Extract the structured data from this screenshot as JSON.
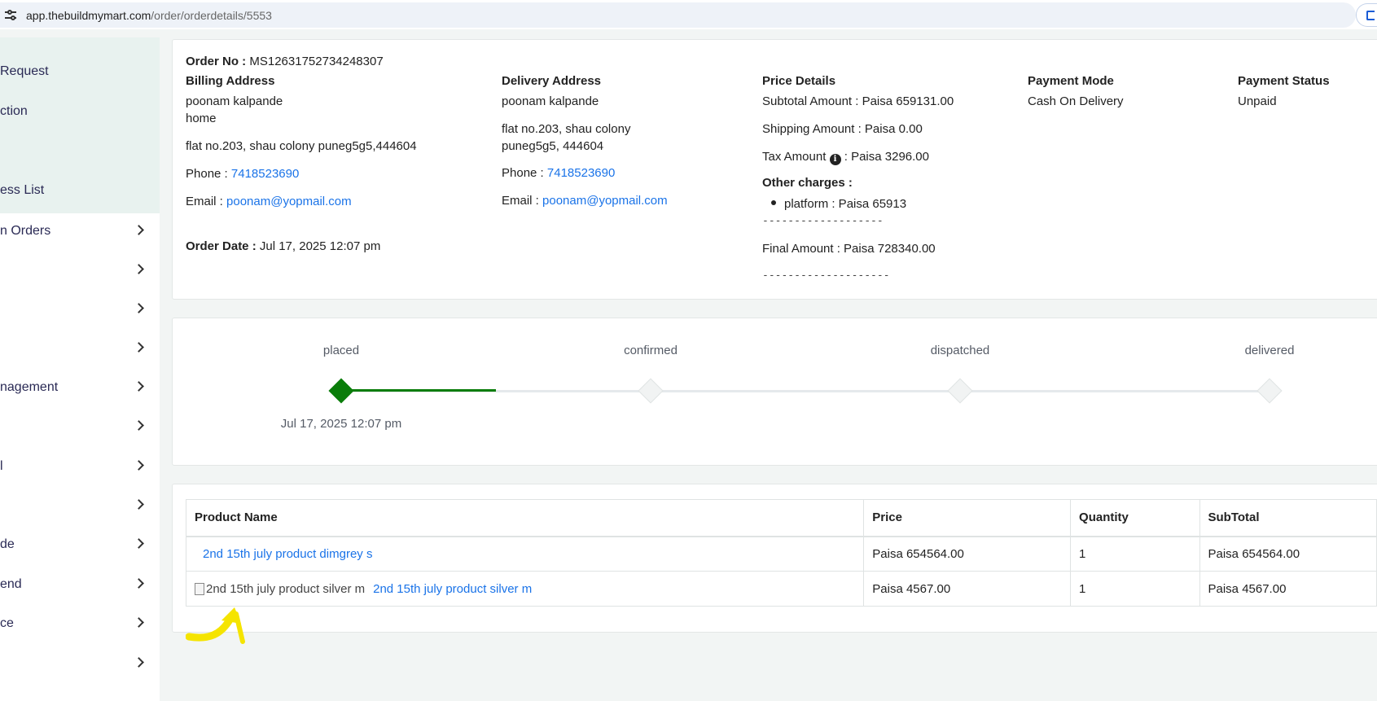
{
  "browser": {
    "url_host": "app.thebuildmymart.com",
    "url_path": "/order/orderdetails/5553"
  },
  "sidebar": {
    "items": [
      {
        "label": "Request",
        "chevron": false
      },
      {
        "label": "ction",
        "chevron": false
      },
      {
        "label": "ess List",
        "chevron": false
      },
      {
        "label": "n Orders",
        "chevron": true
      },
      {
        "label": "",
        "chevron": true
      },
      {
        "label": "",
        "chevron": true
      },
      {
        "label": "",
        "chevron": true
      },
      {
        "label": "nagement",
        "chevron": true
      },
      {
        "label": "",
        "chevron": true
      },
      {
        "label": "l",
        "chevron": true
      },
      {
        "label": "",
        "chevron": true
      },
      {
        "label": "de",
        "chevron": true
      },
      {
        "label": "end",
        "chevron": true
      },
      {
        "label": "ce",
        "chevron": true
      },
      {
        "label": "",
        "chevron": true
      }
    ]
  },
  "order": {
    "order_no_label": "Order No :",
    "order_no": "MS12631752734248307",
    "order_date_label": "Order Date :",
    "order_date": "Jul 17, 2025 12:07 pm"
  },
  "billing": {
    "heading": "Billing Address",
    "name": "poonam kalpande",
    "tag": "home",
    "address": "flat no.203, shau colony puneg5g5,444604",
    "phone_label": "Phone :",
    "phone": "7418523690",
    "email_label": "Email :",
    "email": "poonam@yopmail.com"
  },
  "delivery": {
    "heading": "Delivery Address",
    "name": "poonam kalpande",
    "address_line1": "flat no.203, shau colony",
    "address_line2": "puneg5g5, 444604",
    "phone_label": "Phone :",
    "phone": "7418523690",
    "email_label": "Email :",
    "email": "poonam@yopmail.com"
  },
  "price": {
    "heading": "Price Details",
    "subtotal": "Subtotal Amount : Paisa 659131.00",
    "shipping": "Shipping Amount : Paisa 0.00",
    "tax_label": "Tax Amount",
    "tax_value": ": Paisa  3296.00",
    "other_heading": "Other charges :",
    "other_item": "platform :  Paisa  65913",
    "dashes_short": "-------------------",
    "final": "Final Amount : Paisa  728340.00",
    "dashes_long": "--------------------"
  },
  "payment": {
    "mode_heading": "Payment Mode",
    "mode": "Cash On Delivery",
    "status_heading": "Payment Status",
    "status": "Unpaid"
  },
  "tracker": {
    "steps": [
      "placed",
      "confirmed",
      "dispatched",
      "delivered"
    ],
    "completed_steps": 1,
    "placed_date": "Jul 17, 2025 12:07 pm",
    "done_color": "#0a7d0a"
  },
  "products": {
    "headers": [
      "Product Name",
      "Price",
      "Quantity",
      "SubTotal"
    ],
    "rows": [
      {
        "image_alt": "",
        "name": "2nd 15th july product dimgrey s",
        "price": "Paisa 654564.00",
        "qty": "1",
        "subtotal": "Paisa 654564.00"
      },
      {
        "image_alt": "2nd 15th july product silver m",
        "name": "2nd 15th july product silver m",
        "price": "Paisa 4567.00",
        "qty": "1",
        "subtotal": "Paisa 4567.00"
      }
    ]
  },
  "annotation": {
    "arrow_color": "#f5e400"
  }
}
